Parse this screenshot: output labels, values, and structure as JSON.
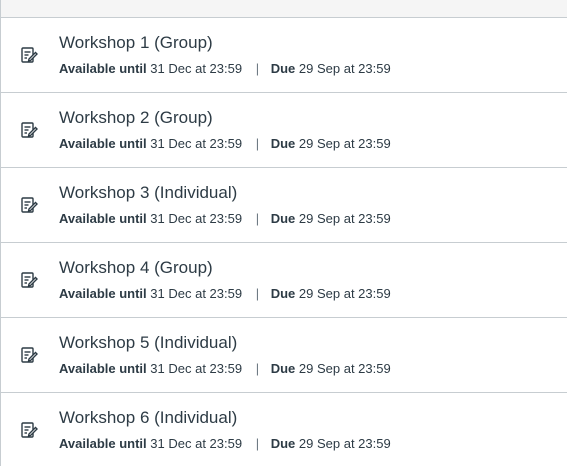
{
  "items": [
    {
      "icon": "assignment-icon",
      "title": "Workshop 1 (Group)",
      "available_label": "Available until",
      "available_value": "31 Dec at 23:59",
      "separator": "|",
      "due_label": "Due",
      "due_value": "29 Sep at 23:59"
    },
    {
      "icon": "assignment-icon",
      "title": "Workshop 2 (Group)",
      "available_label": "Available until",
      "available_value": "31 Dec at 23:59",
      "separator": "|",
      "due_label": "Due",
      "due_value": "29 Sep at 23:59"
    },
    {
      "icon": "assignment-icon",
      "title": "Workshop 3 (Individual)",
      "available_label": "Available until",
      "available_value": "31 Dec at 23:59",
      "separator": "|",
      "due_label": "Due",
      "due_value": "29 Sep at 23:59"
    },
    {
      "icon": "assignment-icon",
      "title": "Workshop 4 (Group)",
      "available_label": "Available until",
      "available_value": "31 Dec at 23:59",
      "separator": "|",
      "due_label": "Due",
      "due_value": "29 Sep at 23:59"
    },
    {
      "icon": "assignment-icon",
      "title": "Workshop 5 (Individual)",
      "available_label": "Available until",
      "available_value": "31 Dec at 23:59",
      "separator": "|",
      "due_label": "Due",
      "due_value": "29 Sep at 23:59"
    },
    {
      "icon": "assignment-icon",
      "title": "Workshop 6 (Individual)",
      "available_label": "Available until",
      "available_value": "31 Dec at 23:59",
      "separator": "|",
      "due_label": "Due",
      "due_value": "29 Sep at 23:59"
    }
  ]
}
